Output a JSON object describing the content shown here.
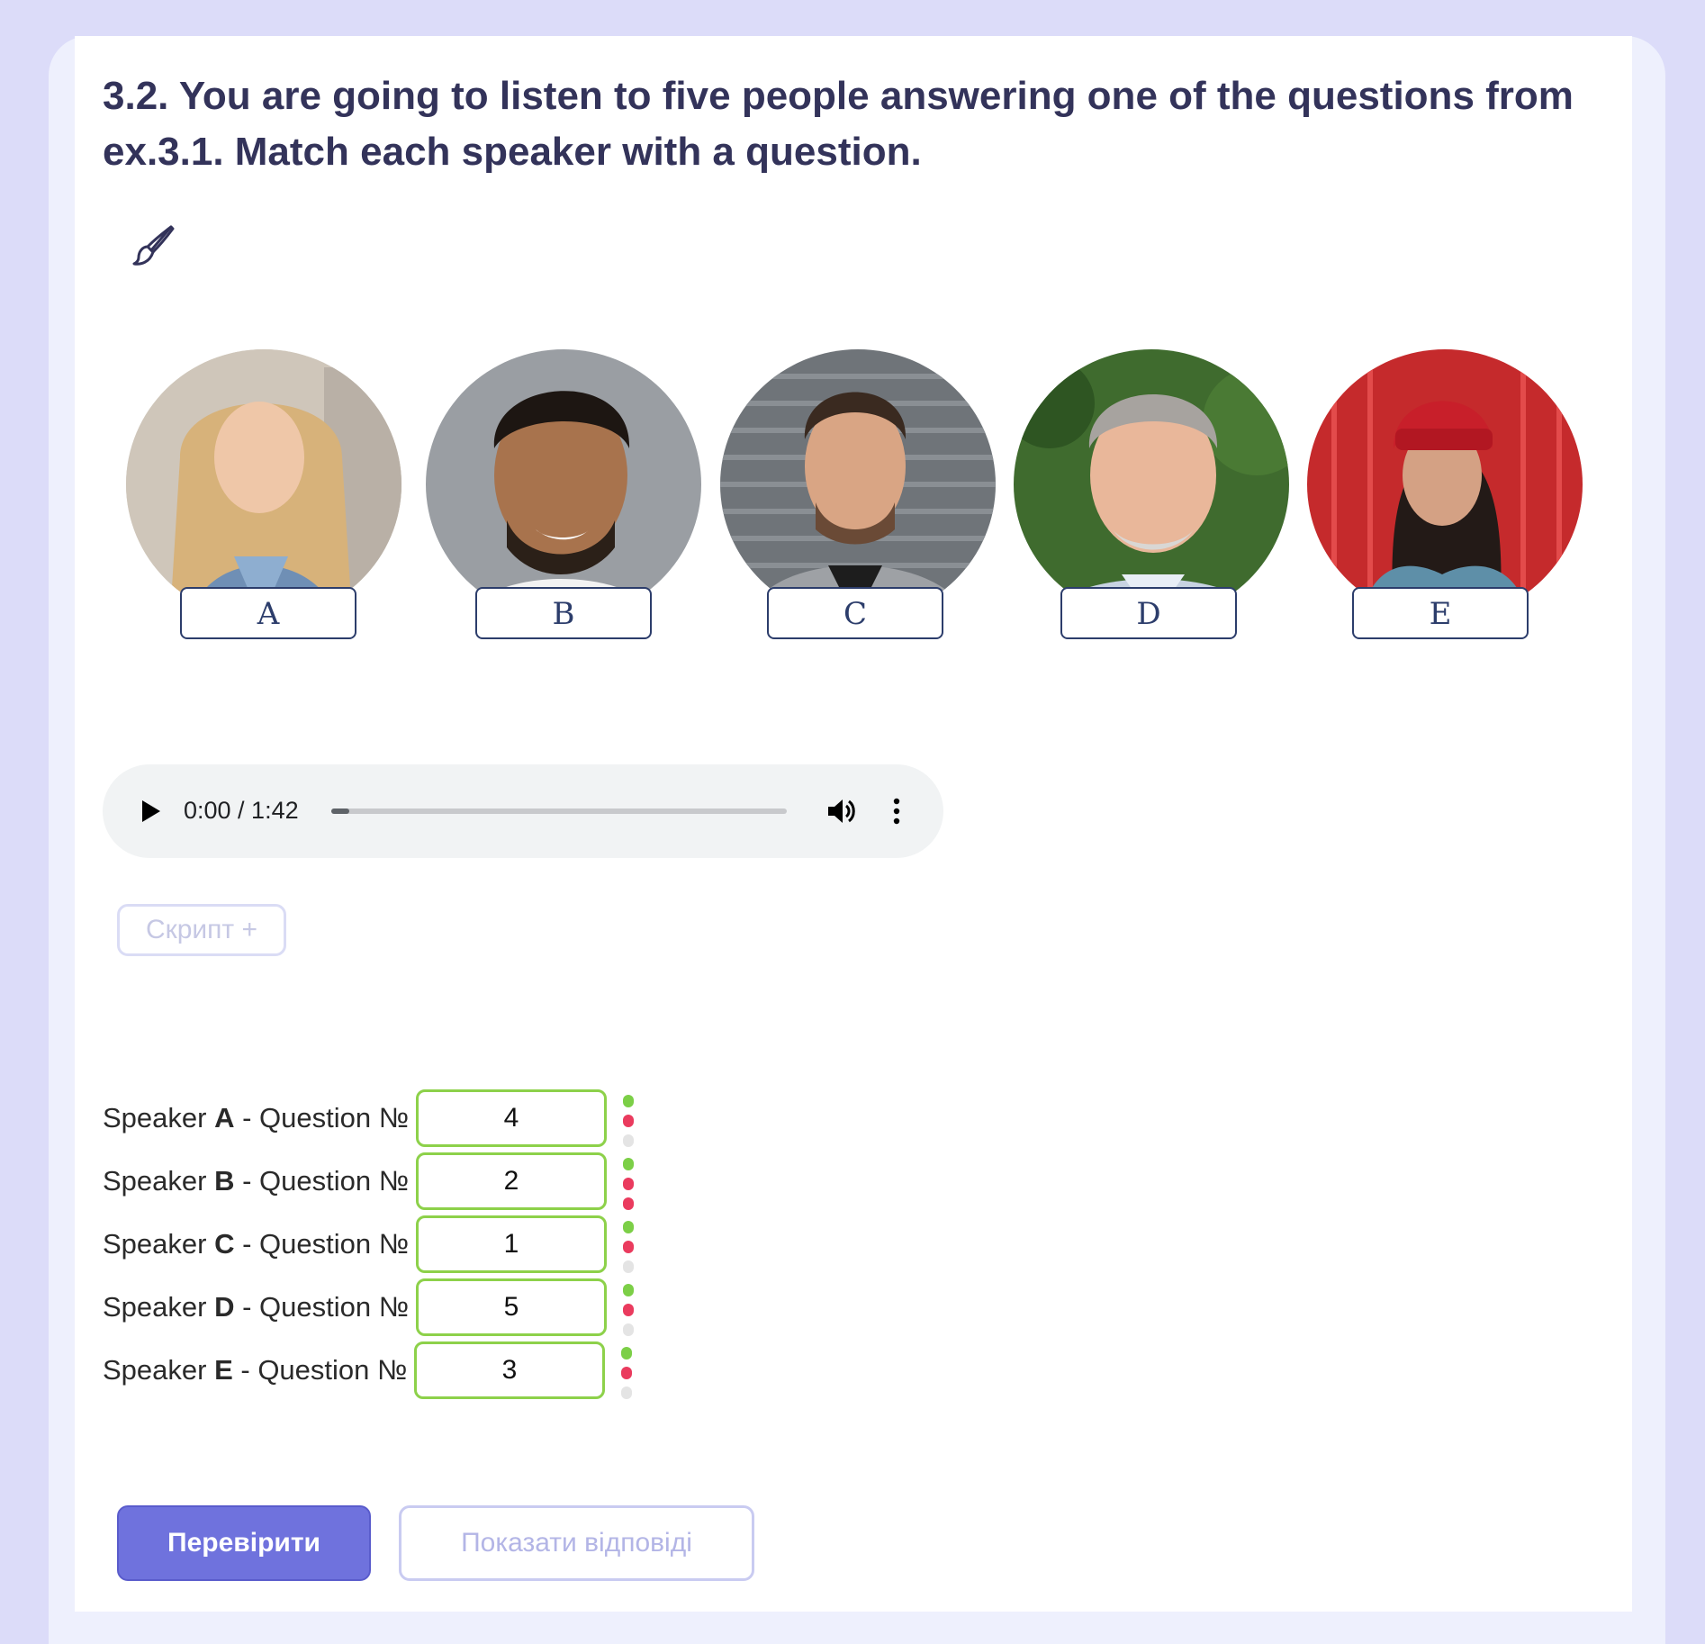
{
  "exercise": {
    "title": "3.2. You are going to listen to five people answering one of the questions from ex.3.1. Match each speaker with a question."
  },
  "speakers": [
    {
      "label": "A"
    },
    {
      "label": "B"
    },
    {
      "label": "C"
    },
    {
      "label": "D"
    },
    {
      "label": "E"
    }
  ],
  "audio": {
    "time": "0:00 / 1:42",
    "progress": 0.04
  },
  "script_button": "Скрипт +",
  "answers": [
    {
      "prefix": "Speaker ",
      "speaker": "A",
      "suffix": " - Question №",
      "value": "4"
    },
    {
      "prefix": "Speaker ",
      "speaker": "B",
      "suffix": " - Question №",
      "value": "2"
    },
    {
      "prefix": "Speaker ",
      "speaker": "C",
      "suffix": " - Question №",
      "value": "1"
    },
    {
      "prefix": "Speaker ",
      "speaker": "D",
      "suffix": " - Question №",
      "value": "5"
    },
    {
      "prefix": "Speaker ",
      "speaker": "E",
      "suffix": " - Question №",
      "value": "3"
    }
  ],
  "buttons": {
    "check": "Перевірити",
    "show_answers": "Показати відповіді"
  },
  "colors": {
    "accent": "#6f72dd",
    "correct": "#8dd14a",
    "wrong": "#ea3b5e",
    "title": "#33335a"
  }
}
